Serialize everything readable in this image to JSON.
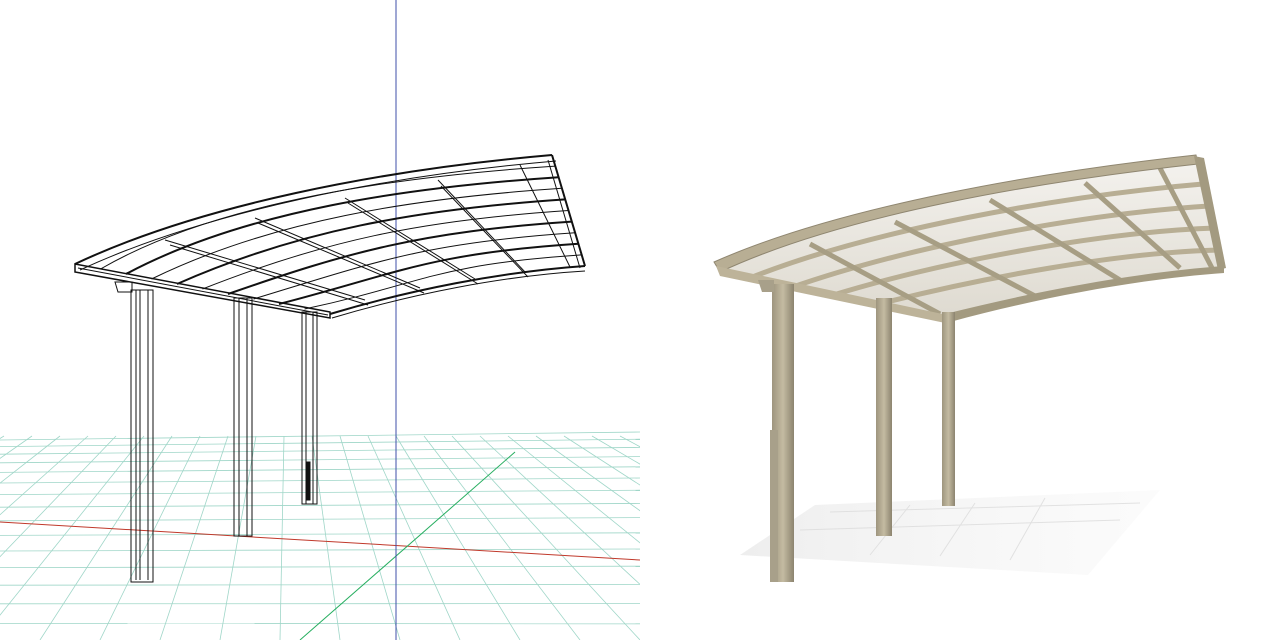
{
  "viewport": {
    "left_view": "wireframe",
    "right_view": "rendered"
  },
  "colors": {
    "background": "#ffffff",
    "grid": "#9fd6c8",
    "axis_x": "#c0392b",
    "axis_y": "#27ae60",
    "axis_z": "#3f4fa8",
    "wire": "#111111",
    "frame": "#b8ae94",
    "frame_dark": "#8f8670",
    "panel_glass": "#ece9e1",
    "floor": "#eeeeee"
  },
  "icons": {
    "left_icon": "wireframe-carport-icon",
    "right_icon": "rendered-carport-icon"
  }
}
